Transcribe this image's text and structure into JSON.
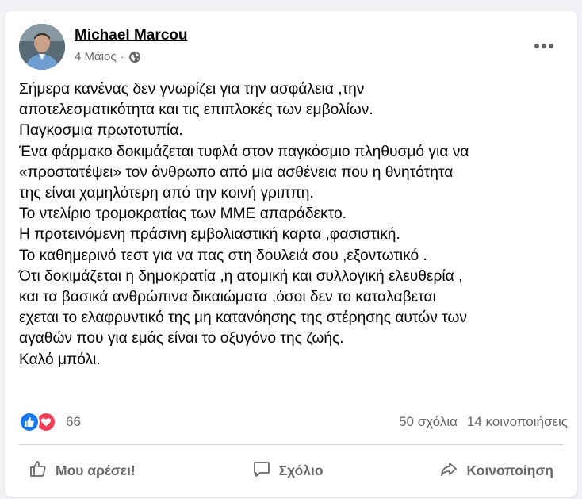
{
  "post": {
    "author": "Michael Marcou",
    "date": "4 Μάιος",
    "separator": "·",
    "privacy_icon": "globe-icon",
    "more_icon": "more-options-icon",
    "text_lines": [
      "Σήμερα κανένας δεν γνωρίζει για την ασφάλεια ,την",
      "αποτελεσματικότητα και τις επιπλοκές των εμβολίων.",
      "Παγκοσμια πρωτοτυπία.",
      "Ένα φάρμακο δοκιμάζεται τυφλά στον παγκόσμιο πληθυσμό για να",
      "«προστατέψει» τον άνθρωπο από μια ασθένεια που η θνητότητα",
      "της είναι χαμηλότερη από την κοινή γριππη.",
      "Το ντελίριο τρομοκρατίας των ΜΜΕ απαράδεκτο.",
      "Η προτεινόμενη πράσινη εμβολιαστική καρτα ,φασιστική.",
      "Το καθημερινό τεστ για να πας στη δουλειά σου ,εξοντωτικό .",
      "Ότι δοκιμάζεται η δημοκρατία ,η ατομική και συλλογική ελευθερία ,",
      "και τα βασικά ανθρώπινα δικαιώματα ,όσοι δεν το καταλαβεται",
      "εχεται το ελαφρυντικό της μη κατανόησης της στέρησης αυτών των",
      "αγαθών που για εμάς είναι το οξυγόνο της ζωής.",
      "Καλό μπόλι."
    ]
  },
  "engagement": {
    "reaction_count": "66",
    "comments": "50 σχόλια",
    "shares": "14 κοινοποιήσεις",
    "colors": {
      "like": "#1877f2",
      "love": "#f33e58"
    }
  },
  "actions": {
    "like": "Μου αρέσει!",
    "comment": "Σχόλιο",
    "share": "Κοινοποίηση"
  }
}
